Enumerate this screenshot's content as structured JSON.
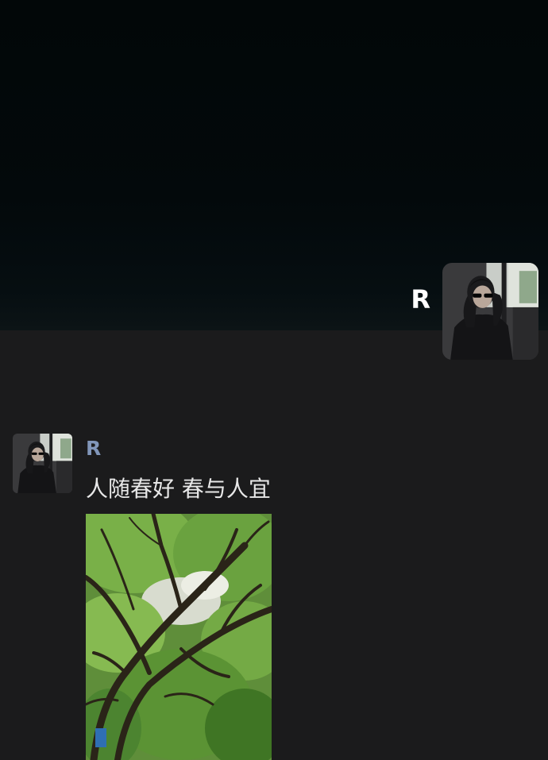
{
  "profile": {
    "name": "R"
  },
  "post": {
    "author": "R",
    "text": "人随春好 春与人宜"
  },
  "colors": {
    "background": "#1b1b1c",
    "cover": "#03090b",
    "name_link": "#8196b9",
    "text": "#e8e8e8"
  }
}
